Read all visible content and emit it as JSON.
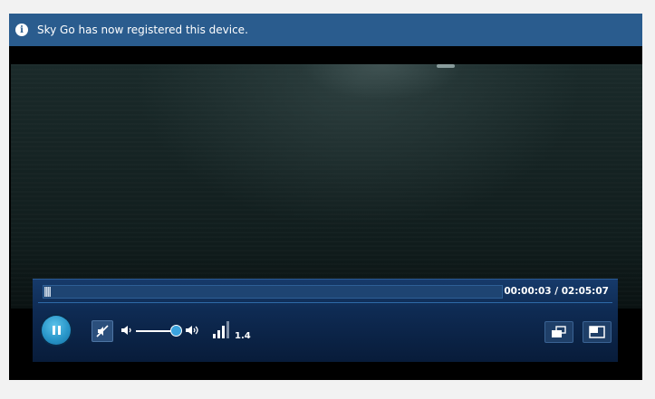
{
  "notification": {
    "icon": "info-icon",
    "message": "Sky Go has now registered this device."
  },
  "player": {
    "time_display": "00:00:03 / 02:05:07",
    "progress_fraction": 0.0004,
    "volume_fraction": 1.0,
    "muted": true,
    "bitrate_value": "1.4",
    "controls": {
      "play_pause": "pause-icon",
      "mute": "mute-icon",
      "volume_low": "volume-low-icon",
      "volume_high": "volume-high-icon",
      "bitrate": "signal-bars-icon",
      "swap_screen": "swap-screen-icon",
      "popout": "popout-window-icon"
    }
  },
  "colors": {
    "notice_bg": "#2a5c8e",
    "controls_bg": "#0e2a52",
    "play_accent": "#2996c9"
  }
}
